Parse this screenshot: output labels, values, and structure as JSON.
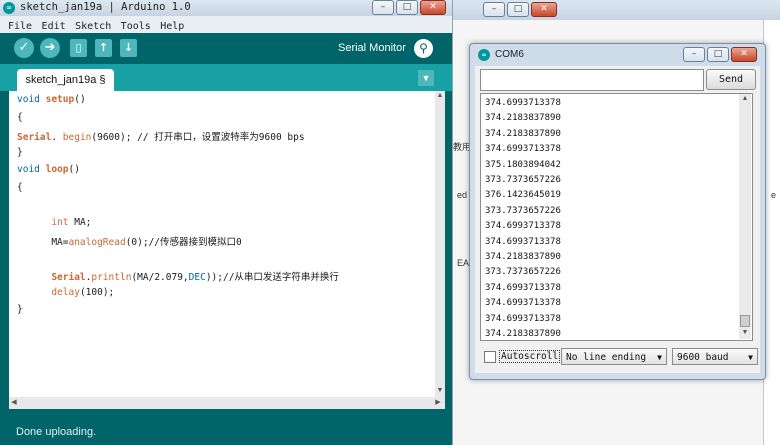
{
  "ide": {
    "title": "sketch_jan19a | Arduino 1.0",
    "menu": [
      "File",
      "Edit",
      "Sketch",
      "Tools",
      "Help"
    ],
    "serial_monitor_label": "Serial Monitor",
    "tab_label": "sketch_jan19a §",
    "code": [
      {
        "parts": [
          [
            "kw2",
            "void "
          ],
          [
            "fn",
            "setup"
          ],
          [
            "",
            "()"
          ]
        ]
      },
      {
        "parts": [
          [
            "",
            "{"
          ]
        ]
      },
      {
        "parts": [
          [
            "",
            ""
          ],
          [
            "fn",
            "Serial"
          ],
          [
            "",
            ". "
          ],
          [
            "kw",
            "begin"
          ],
          [
            "",
            "(9600); // 打开串口，设置波特率为9600 bps"
          ]
        ]
      },
      {
        "parts": [
          [
            "",
            "}"
          ]
        ]
      },
      {
        "parts": [
          [
            "kw2",
            "void "
          ],
          [
            "fn",
            "loop"
          ],
          [
            "",
            "()"
          ]
        ]
      },
      {
        "parts": [
          [
            "",
            "{"
          ]
        ]
      },
      {
        "parts": [
          [
            "",
            ""
          ]
        ]
      },
      {
        "parts": [
          [
            "",
            "      "
          ],
          [
            "kw",
            "int"
          ],
          [
            "",
            " MA;"
          ]
        ]
      },
      {
        "parts": [
          [
            "",
            "      MA="
          ],
          [
            "kw",
            "analogRead"
          ],
          [
            "",
            "(0);//传感器接到模拟口0"
          ]
        ]
      },
      {
        "parts": [
          [
            "",
            ""
          ]
        ]
      },
      {
        "parts": [
          [
            "",
            "      "
          ],
          [
            "fn",
            "Serial"
          ],
          [
            "",
            "."
          ],
          [
            "kw",
            "println"
          ],
          [
            "",
            "(MA/2.079,"
          ],
          [
            "kw2",
            "DEC"
          ],
          [
            "",
            "));//从串口发送字符串并换行"
          ]
        ]
      },
      {
        "parts": [
          [
            "",
            "      "
          ],
          [
            "kw",
            "delay"
          ],
          [
            "",
            "(100);"
          ]
        ]
      },
      {
        "parts": [
          [
            "",
            "}"
          ]
        ]
      }
    ],
    "status": "Done uploading."
  },
  "com": {
    "title": "COM6",
    "send_label": "Send",
    "send_value": "",
    "output": [
      "374.6993713378",
      "374.2183837890",
      "374.2183837890",
      "374.6993713378",
      "375.1803894042",
      "373.7373657226",
      "376.1423645019",
      "373.7373657226",
      "374.6993713378",
      "374.6993713378",
      "374.2183837890",
      "373.7373657226",
      "374.6993713378",
      "374.6993713378",
      "374.6993713378",
      "374.2183837890"
    ],
    "autoscroll_label": "Autoscroll",
    "line_ending": "No line ending",
    "baud": "9600 baud"
  },
  "background": {
    "fragments": [
      "教用",
      "ed",
      "EA",
      "e"
    ]
  }
}
